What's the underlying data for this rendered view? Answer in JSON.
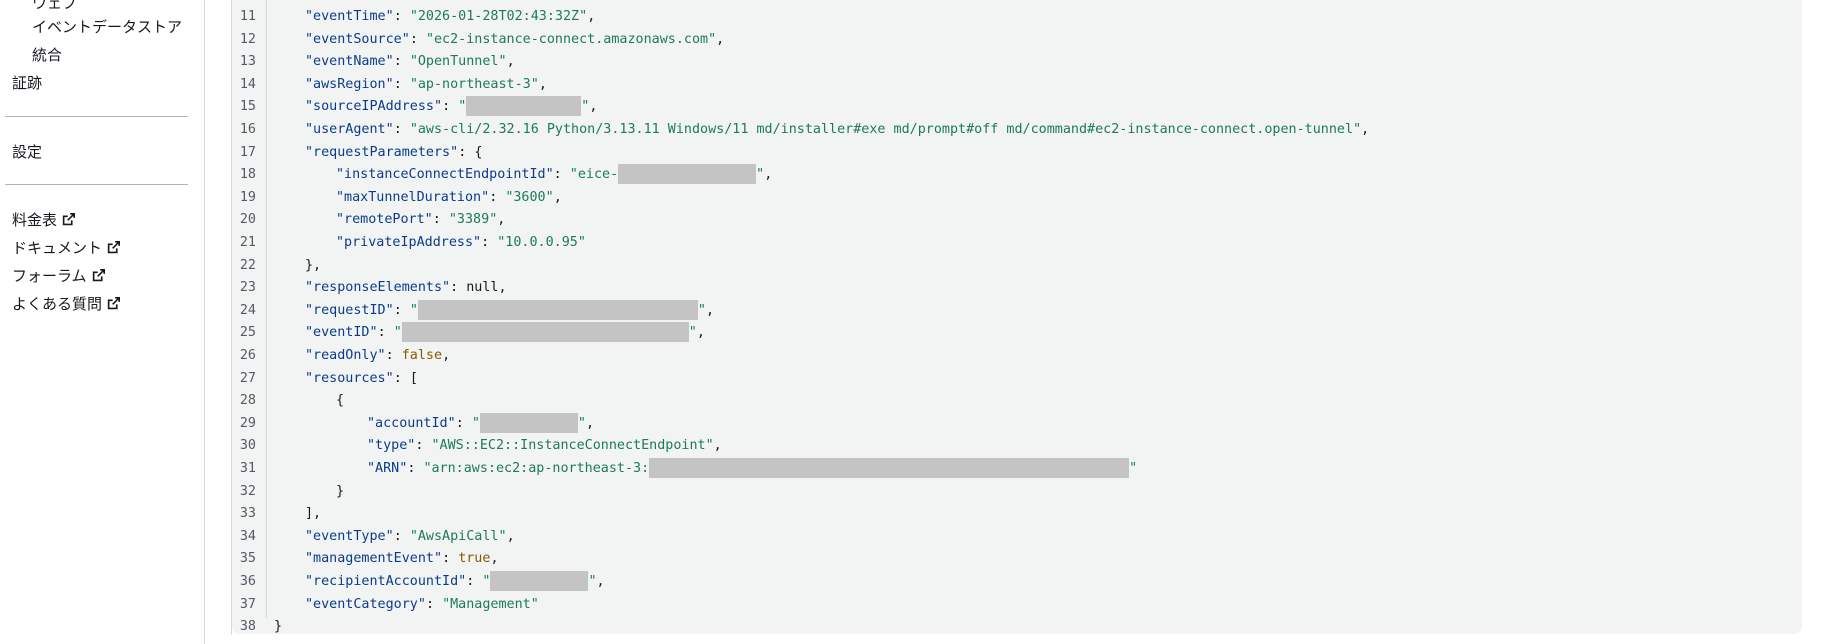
{
  "sidebar": {
    "items_sub": [
      {
        "label": "ウェブ",
        "y": -6
      },
      {
        "label": "イベントデータストア",
        "y": 16
      },
      {
        "label": "統合",
        "y": 44
      }
    ],
    "items_top": [
      {
        "label": "証跡"
      },
      {
        "label": "設定"
      }
    ],
    "external_links": [
      {
        "label": "料金表"
      },
      {
        "label": "ドキュメント"
      },
      {
        "label": "フォーラム"
      },
      {
        "label": "よくある質問"
      }
    ]
  },
  "code": {
    "lines": [
      {
        "num": "11",
        "key": "eventTime",
        "value": "2026-01-28T02:43:32Z",
        "suffix": ","
      },
      {
        "num": "12",
        "key": "eventSource",
        "value": "ec2-instance-connect.amazonaws.com",
        "suffix": ","
      },
      {
        "num": "13",
        "key": "eventName",
        "value": "OpenTunnel",
        "suffix": ","
      },
      {
        "num": "14",
        "key": "awsRegion",
        "value": "ap-northeast-3",
        "suffix": ","
      },
      {
        "num": "15",
        "key": "sourceIPAddress",
        "value": "",
        "suffix": ","
      },
      {
        "num": "16",
        "key": "userAgent",
        "value": "aws-cli/2.32.16 Python/3.13.11 Windows/11 md/installer#exe md/prompt#off md/command#ec2-instance-connect.open-tunnel",
        "suffix": ","
      },
      {
        "num": "17",
        "key": "requestParameters",
        "raw": "{"
      },
      {
        "num": "18",
        "key": "instanceConnectEndpointId",
        "value": "eice-",
        "suffix": ","
      },
      {
        "num": "19",
        "key": "maxTunnelDuration",
        "value": "3600",
        "suffix": ","
      },
      {
        "num": "20",
        "key": "remotePort",
        "value": "3389",
        "suffix": ","
      },
      {
        "num": "21",
        "key": "privateIpAddress",
        "value": "10.0.0.95",
        "suffix": ""
      },
      {
        "num": "22",
        "raw": "},"
      },
      {
        "num": "23",
        "key": "responseElements",
        "raw": "null,"
      },
      {
        "num": "24",
        "key": "requestID",
        "value": "",
        "suffix": ","
      },
      {
        "num": "25",
        "key": "eventID",
        "value": "",
        "suffix": ","
      },
      {
        "num": "26",
        "key": "readOnly",
        "bool": "false",
        "suffix": ","
      },
      {
        "num": "27",
        "key": "resources",
        "raw": "["
      },
      {
        "num": "28",
        "raw": "{"
      },
      {
        "num": "29",
        "key": "accountId",
        "value": "",
        "suffix": ","
      },
      {
        "num": "30",
        "key": "type",
        "value": "AWS::EC2::InstanceConnectEndpoint",
        "suffix": ","
      },
      {
        "num": "31",
        "key": "ARN",
        "value": "arn:aws:ec2:ap-northeast-3:",
        "suffix": ""
      },
      {
        "num": "32",
        "raw": "}"
      },
      {
        "num": "33",
        "raw": "],"
      },
      {
        "num": "34",
        "key": "eventType",
        "value": "AwsApiCall",
        "suffix": ","
      },
      {
        "num": "35",
        "key": "managementEvent",
        "bool": "true",
        "suffix": ","
      },
      {
        "num": "36",
        "key": "recipientAccountId",
        "value": "",
        "suffix": ","
      },
      {
        "num": "37",
        "key": "eventCategory",
        "value": "Management",
        "suffix": ""
      },
      {
        "num": "38",
        "raw": "}"
      }
    ]
  }
}
